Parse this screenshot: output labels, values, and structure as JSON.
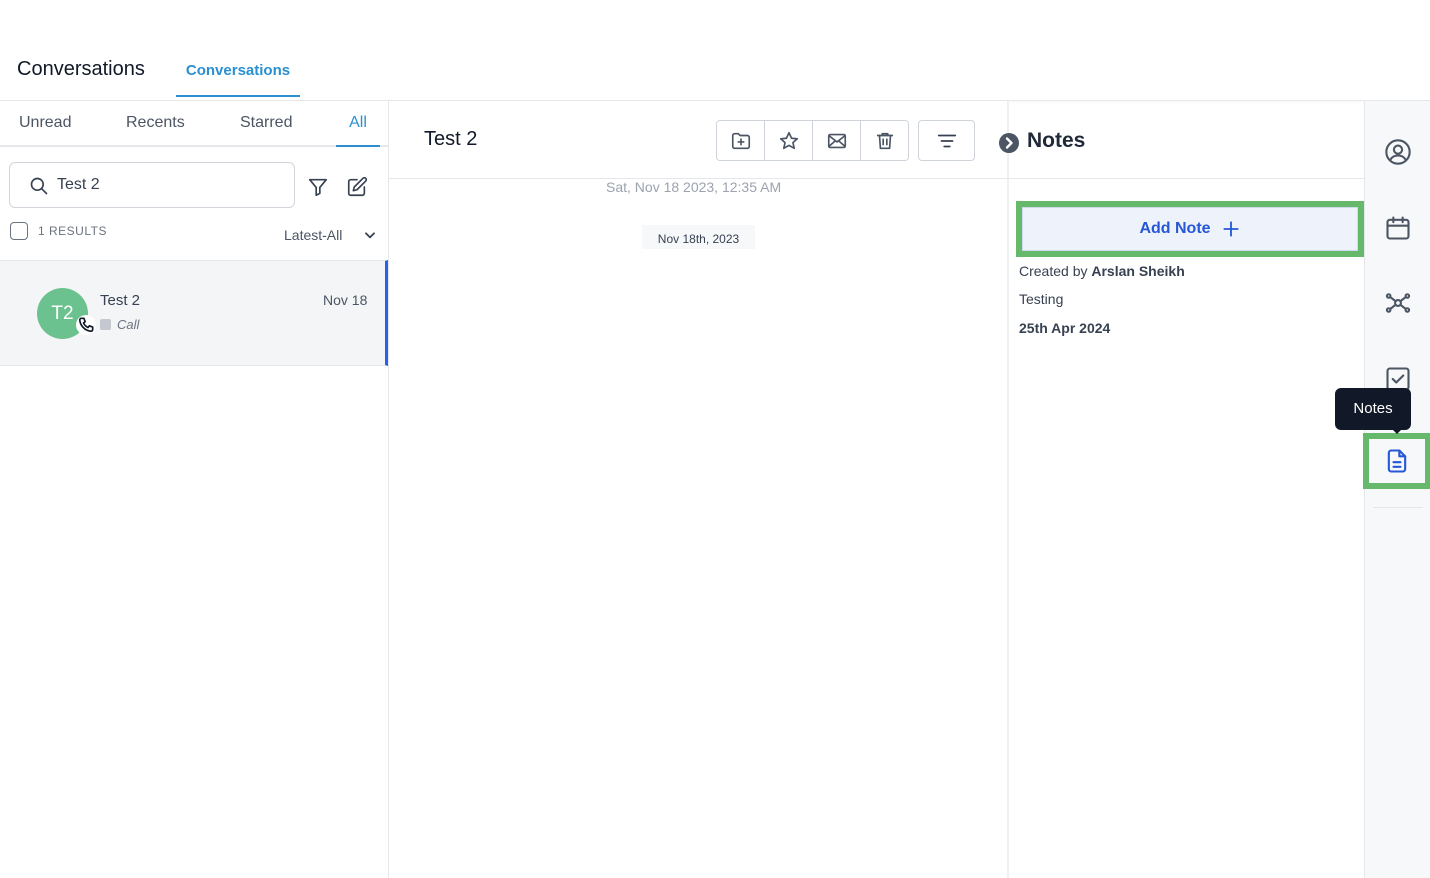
{
  "header": {
    "app_title": "Conversations",
    "tab_label": "Conversations"
  },
  "left": {
    "filter_tabs": [
      {
        "label": "Unread"
      },
      {
        "label": "Recents"
      },
      {
        "label": "Starred"
      },
      {
        "label": "All",
        "active": true
      }
    ],
    "search": {
      "value": "Test 2"
    },
    "results_count": "1 RESULTS",
    "sort_label": "Latest-All",
    "conversations": [
      {
        "initials": "T2",
        "name": "Test 2",
        "date": "Nov 18",
        "type": "Call"
      }
    ]
  },
  "middle": {
    "title": "Test 2",
    "message_time": "Sat, Nov 18 2023, 12:35 AM",
    "date_divider": "Nov 18th, 2023"
  },
  "notes": {
    "title": "Notes",
    "add_label": "Add Note",
    "created_by_label": "Created by",
    "author": "Arslan Sheikh",
    "body": "Testing",
    "date": "25th Apr 2024"
  },
  "rail": {
    "tooltip": "Notes",
    "icons": [
      "user-circle-icon",
      "calendar-icon",
      "network-icon",
      "checkbox-icon",
      "document-icon"
    ]
  },
  "colors": {
    "accent": "#2b8fd0",
    "primary_button": "#2557d6",
    "highlight": "#66b96a",
    "avatar": "#6cc28f",
    "tooltip": "#111827"
  }
}
